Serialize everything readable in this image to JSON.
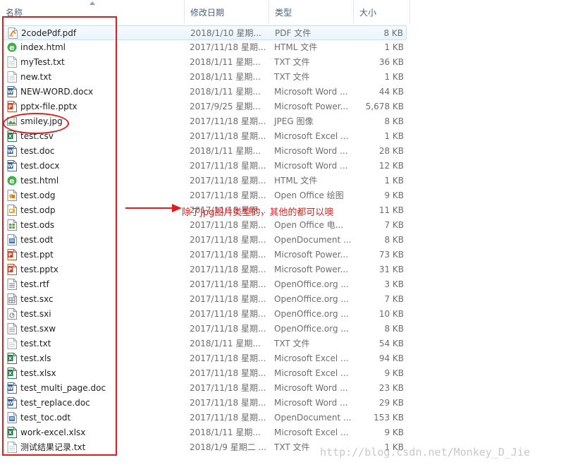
{
  "columns": {
    "name": "名称",
    "date": "修改日期",
    "type": "类型",
    "size": "大小"
  },
  "files": [
    {
      "name": "2codePdf.pdf",
      "date": "2018/1/10 星期...",
      "type": "PDF 文件",
      "size": "8 KB",
      "icon": "pdf-icon"
    },
    {
      "name": "index.html",
      "date": "2017/11/18 星期...",
      "type": "HTML 文件",
      "size": "1 KB",
      "icon": "html-icon"
    },
    {
      "name": "myTest.txt",
      "date": "2018/1/11 星期...",
      "type": "TXT 文件",
      "size": "36 KB",
      "icon": "txt-icon"
    },
    {
      "name": "new.txt",
      "date": "2018/1/11 星期...",
      "type": "TXT 文件",
      "size": "1 KB",
      "icon": "txt-icon"
    },
    {
      "name": "NEW-WORD.docx",
      "date": "2018/1/11 星期...",
      "type": "Microsoft Word ...",
      "size": "44 KB",
      "icon": "word-icon"
    },
    {
      "name": "pptx-file.pptx",
      "date": "2017/9/25 星期...",
      "type": "Microsoft Power...",
      "size": "5,678 KB",
      "icon": "powerpoint-icon"
    },
    {
      "name": "smiley.jpg",
      "date": "2017/11/18 星期...",
      "type": "JPEG 图像",
      "size": "8 KB",
      "icon": "image-icon"
    },
    {
      "name": "test.csv",
      "date": "2017/11/18 星期...",
      "type": "Microsoft Excel ...",
      "size": "1 KB",
      "icon": "excel-icon"
    },
    {
      "name": "test.doc",
      "date": "2018/1/11 星期...",
      "type": "Microsoft Word ...",
      "size": "28 KB",
      "icon": "word-icon"
    },
    {
      "name": "test.docx",
      "date": "2017/11/18 星期...",
      "type": "Microsoft Word ...",
      "size": "12 KB",
      "icon": "word-icon"
    },
    {
      "name": "test.html",
      "date": "2017/11/18 星期...",
      "type": "HTML 文件",
      "size": "1 KB",
      "icon": "html-icon"
    },
    {
      "name": "test.odg",
      "date": "2017/11/18 星期...",
      "type": "Open Office 绘图",
      "size": "9 KB",
      "icon": "odg-icon"
    },
    {
      "name": "test.odp",
      "date": "2017/11/18 星期...",
      "type": "",
      "size": "11 KB",
      "icon": "odp-icon"
    },
    {
      "name": "test.ods",
      "date": "2017/11/18 星期...",
      "type": "Open Office 电...",
      "size": "7 KB",
      "icon": "ods-icon"
    },
    {
      "name": "test.odt",
      "date": "2017/11/18 星期...",
      "type": "OpenDocument ...",
      "size": "8 KB",
      "icon": "odt-icon"
    },
    {
      "name": "test.ppt",
      "date": "2017/11/18 星期...",
      "type": "Microsoft Power...",
      "size": "73 KB",
      "icon": "powerpoint-icon"
    },
    {
      "name": "test.pptx",
      "date": "2017/11/18 星期...",
      "type": "Microsoft Power...",
      "size": "31 KB",
      "icon": "powerpoint-icon"
    },
    {
      "name": "test.rtf",
      "date": "2017/11/18 星期...",
      "type": "OpenOffice.org ...",
      "size": "3 KB",
      "icon": "rtf-icon"
    },
    {
      "name": "test.sxc",
      "date": "2017/11/18 星期...",
      "type": "OpenOffice.org ...",
      "size": "7 KB",
      "icon": "sxc-icon"
    },
    {
      "name": "test.sxi",
      "date": "2017/11/18 星期...",
      "type": "OpenOffice.org ...",
      "size": "10 KB",
      "icon": "sxi-icon"
    },
    {
      "name": "test.sxw",
      "date": "2017/11/18 星期...",
      "type": "OpenOffice.org ...",
      "size": "8 KB",
      "icon": "sxw-icon"
    },
    {
      "name": "test.txt",
      "date": "2018/1/11 星期...",
      "type": "TXT 文件",
      "size": "54 KB",
      "icon": "txt-icon"
    },
    {
      "name": "test.xls",
      "date": "2017/11/18 星期...",
      "type": "Microsoft Excel ...",
      "size": "94 KB",
      "icon": "excel-icon"
    },
    {
      "name": "test.xlsx",
      "date": "2017/11/18 星期...",
      "type": "Microsoft Excel ...",
      "size": "9 KB",
      "icon": "excel-icon"
    },
    {
      "name": "test_multi_page.doc",
      "date": "2017/11/18 星期...",
      "type": "Microsoft Word ...",
      "size": "23 KB",
      "icon": "word-icon"
    },
    {
      "name": "test_replace.doc",
      "date": "2017/11/18 星期...",
      "type": "Microsoft Word ...",
      "size": "29 KB",
      "icon": "word-icon"
    },
    {
      "name": "test_toc.odt",
      "date": "2017/11/18 星期...",
      "type": "OpenDocument ...",
      "size": "153 KB",
      "icon": "odt-icon"
    },
    {
      "name": "work-excel.xlsx",
      "date": "2018/1/11 星期...",
      "type": "Microsoft Excel ...",
      "size": "9 KB",
      "icon": "excel-icon"
    },
    {
      "name": "测试结果记录.txt",
      "date": "2018/1/9 星期二 ...",
      "type": "TXT 文件",
      "size": "1 KB",
      "icon": "txt-icon"
    }
  ],
  "annotation": "除了Jpg图片类型的，其他的都可以噢",
  "watermark": "http://blog.csdn.net/Monkey_D_Jie",
  "colors": {
    "annotation_red": "#e21c1c",
    "header_text": "#4c607a",
    "hover_row": "#eaf4fc"
  }
}
